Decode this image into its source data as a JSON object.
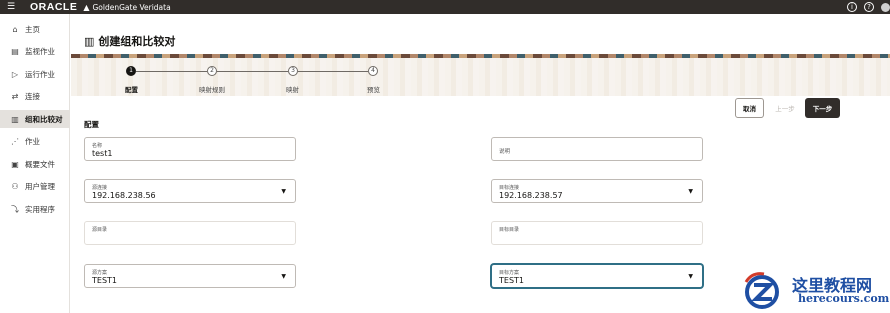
{
  "topbar": {
    "brand": "ORACLE",
    "product_icon": "goldengate-icon",
    "product": "GoldenGate Veridata",
    "help_icon": "info-icon",
    "question_icon": "help-icon",
    "menu_icon": "hamburger-icon",
    "brand_color": "#312d2a"
  },
  "sidebar": {
    "items": [
      {
        "label": "主页",
        "icon": "home-icon"
      },
      {
        "label": "监视作业",
        "icon": "monitor-icon"
      },
      {
        "label": "运行作业",
        "icon": "run-icon"
      },
      {
        "label": "连接",
        "icon": "connection-icon"
      },
      {
        "label": "组和比较对",
        "icon": "groups-icon",
        "active": true
      },
      {
        "label": "作业",
        "icon": "jobs-icon"
      },
      {
        "label": "概要文件",
        "icon": "profile-icon"
      },
      {
        "label": "用户管理",
        "icon": "users-icon"
      },
      {
        "label": "实用程序",
        "icon": "utilities-icon"
      }
    ]
  },
  "page": {
    "title": "创建组和比较对",
    "title_icon": "columns-icon",
    "section_title": "配置"
  },
  "stepper": {
    "steps": [
      {
        "number": "1",
        "label": "配置",
        "active": true
      },
      {
        "number": "2",
        "label": "映射规则"
      },
      {
        "number": "3",
        "label": "映射"
      },
      {
        "number": "4",
        "label": "预览"
      }
    ]
  },
  "buttons": {
    "cancel": "取消",
    "previous": "上一步",
    "next": "下一步"
  },
  "form": {
    "name_label": "名称",
    "name_value": "test1",
    "desc_label": "说明",
    "desc_value": "",
    "src_conn_label": "源连接",
    "src_conn_value": "192.168.238.56",
    "tgt_conn_label": "目标连接",
    "tgt_conn_value": "192.168.238.57",
    "src_catalog_label": "源目录",
    "src_catalog_value": "",
    "tgt_catalog_label": "目标目录",
    "tgt_catalog_value": "",
    "src_schema_label": "源方案",
    "src_schema_value": "TEST1",
    "tgt_schema_label": "目标方案",
    "tgt_schema_value": "TEST1",
    "caret": "▼"
  },
  "watermark": {
    "cn": "这里教程网",
    "en": "herecours.com"
  }
}
